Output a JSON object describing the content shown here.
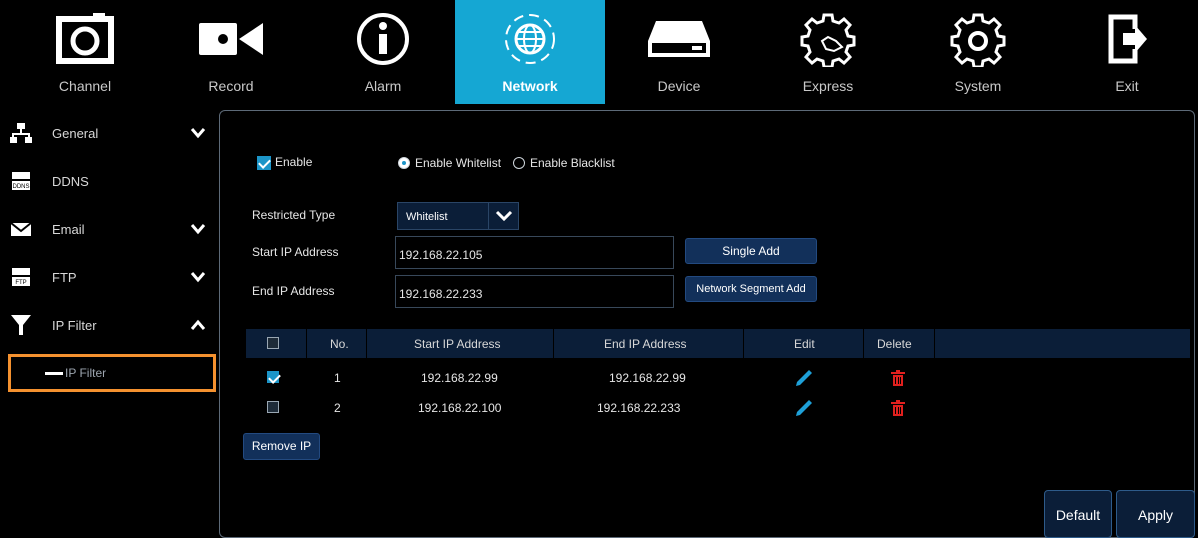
{
  "topnav": {
    "items": [
      {
        "label": "Channel",
        "icon": "camera-icon"
      },
      {
        "label": "Record",
        "icon": "video-camera-icon"
      },
      {
        "label": "Alarm",
        "icon": "info-icon"
      },
      {
        "label": "Network",
        "icon": "globe-icon",
        "active": true
      },
      {
        "label": "Device",
        "icon": "hard-drive-icon"
      },
      {
        "label": "Express",
        "icon": "gear-hand-icon"
      },
      {
        "label": "System",
        "icon": "gear-icon"
      },
      {
        "label": "Exit",
        "icon": "exit-icon"
      }
    ],
    "active_color": "#15a7d3"
  },
  "sidebar": {
    "items": [
      {
        "label": "General",
        "icon": "network-tree-icon",
        "chevron": "down"
      },
      {
        "label": "DDNS",
        "icon": "ddns-icon"
      },
      {
        "label": "Email",
        "icon": "envelope-icon",
        "chevron": "down"
      },
      {
        "label": "FTP",
        "icon": "ftp-icon",
        "chevron": "down"
      },
      {
        "label": "IP Filter",
        "icon": "filter-icon",
        "chevron": "up"
      }
    ],
    "sub_item": {
      "label": "IP Filter"
    },
    "highlight_color": "#f4912f"
  },
  "form": {
    "enable_label": "Enable",
    "enable_checked": true,
    "whitelist_label": "Enable Whitelist",
    "blacklist_label": "Enable Blacklist",
    "selected_mode": "whitelist",
    "restricted_type_label": "Restricted Type",
    "restricted_type_value": "Whitelist",
    "start_ip_label": "Start IP Address",
    "start_ip_value": "192.168.22.105",
    "end_ip_label": "End IP Address",
    "end_ip_value": "192.168.22.233",
    "single_add_label": "Single Add",
    "segment_add_label": "Network Segment Add"
  },
  "table": {
    "headers": {
      "no": "No.",
      "start": "Start IP Address",
      "end": "End IP Address",
      "edit": "Edit",
      "delete": "Delete"
    },
    "rows": [
      {
        "checked": true,
        "no": "1",
        "start": "192.168.22.99",
        "end": "192.168.22.99"
      },
      {
        "checked": false,
        "no": "2",
        "start": "192.168.22.100",
        "end": "192.168.22.233"
      }
    ],
    "remove_label": "Remove IP"
  },
  "footer": {
    "default_label": "Default",
    "apply_label": "Apply"
  }
}
